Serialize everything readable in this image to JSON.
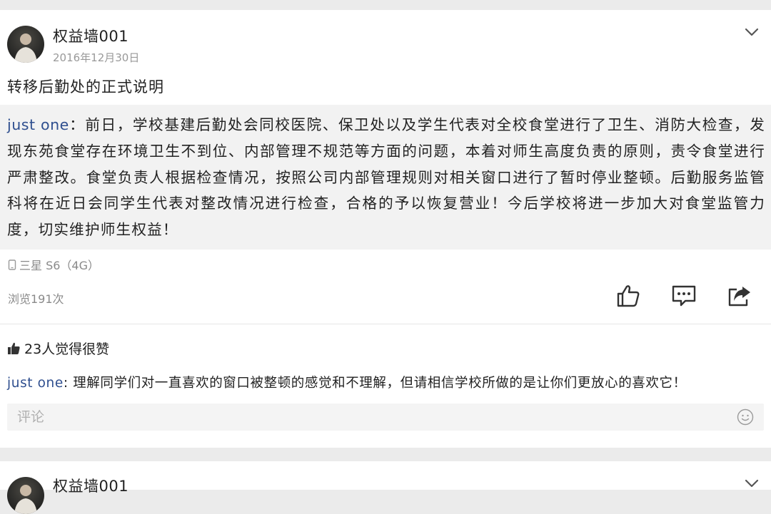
{
  "post": {
    "username": "权益墙001",
    "date": "2016年12月30日",
    "title": "转移后勤处的正式说明",
    "quote_author": "just one",
    "quote_separator": "：",
    "quote_body": "前日，学校基建后勤处会同校医院、保卫处以及学生代表对全校食堂进行了卫生、消防大检查，发现东苑食堂存在环境卫生不到位、内部管理不规范等方面的问题，本着对师生高度负责的原则，责令食堂进行严肃整改。食堂负责人根据检查情况，按照公司内部管理规则对相关窗口进行了暂时停业整顿。后勤服务监管科将在近日会同学生代表对整改情况进行检查，合格的予以恢复营业！今后学校将进一步加大对食堂监管力度，切实维护师生权益！",
    "device": "三星 S6（4G）",
    "views": "浏览191次",
    "likes_text": "23人觉得很赞",
    "comment": {
      "author": "just one",
      "separator": ": ",
      "text": "理解同学们对一直喜欢的窗口被整顿的感觉和不理解，但请相信学校所做的是让你们更放心的喜欢它！"
    },
    "comment_placeholder": "评论"
  },
  "next_post": {
    "username": "权益墙001"
  },
  "icons": {
    "like": "thumbs-up-icon",
    "comment": "speech-bubble-icon",
    "share": "share-icon",
    "more": "chevron-down-icon",
    "device": "phone-icon",
    "emoji": "smiley-icon"
  },
  "colors": {
    "author_link": "#2f4f8f",
    "background": "#ebebeb",
    "quote_background": "#f2f2f2"
  }
}
